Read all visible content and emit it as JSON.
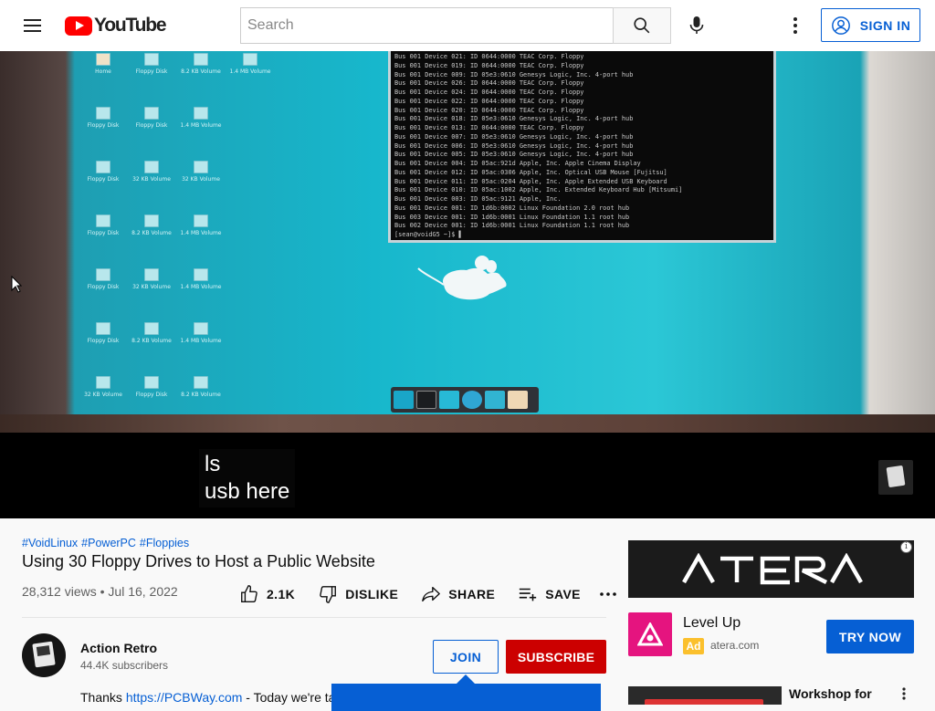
{
  "header": {
    "logo_text": "YouTube",
    "search_placeholder": "Search",
    "sign_in_label": "SIGN IN"
  },
  "player": {
    "terminal_lines": [
      "Bus 001 Device 021: ID 0644:0000 TEAC Corp. Floppy",
      "Bus 001 Device 019: ID 0644:0000 TEAC Corp. Floppy",
      "Bus 001 Device 009: ID 05e3:0610 Genesys Logic, Inc. 4-port hub",
      "Bus 001 Device 026: ID 0644:0000 TEAC Corp. Floppy",
      "Bus 001 Device 024: ID 0644:0000 TEAC Corp. Floppy",
      "Bus 001 Device 022: ID 0644:0000 TEAC Corp. Floppy",
      "Bus 001 Device 020: ID 0644:0000 TEAC Corp. Floppy",
      "Bus 001 Device 018: ID 05e3:0610 Genesys Logic, Inc. 4-port hub",
      "Bus 001 Device 013: ID 0644:0000 TEAC Corp. Floppy",
      "Bus 001 Device 007: ID 05e3:0610 Genesys Logic, Inc. 4-port hub",
      "Bus 001 Device 006: ID 05e3:0610 Genesys Logic, Inc. 4-port hub",
      "Bus 001 Device 005: ID 05e3:0610 Genesys Logic, Inc. 4-port hub",
      "Bus 001 Device 004: ID 05ac:921d Apple, Inc. Apple Cinema Display",
      "Bus 001 Device 012: ID 05ac:0306 Apple, Inc. Optical USB Mouse [Fujitsu]",
      "Bus 001 Device 011: ID 05ac:0204 Apple, Inc. Apple Extended USB Keyboard",
      "Bus 001 Device 010: ID 05ac:1002 Apple, Inc. Extended Keyboard Hub [Mitsumi]",
      "Bus 001 Device 003: ID 05ac:9121 Apple, Inc.",
      "Bus 001 Device 001: ID 1d6b:0002 Linux Foundation 2.0 root hub",
      "Bus 003 Device 001: ID 1d6b:0001 Linux Foundation 1.1 root hub",
      "Bus 002 Device 001: ID 1d6b:0001 Linux Foundation 1.1 root hub",
      "[sean@voidG5 ~]$ ▌"
    ],
    "desktop_icons": [
      "Home",
      "Floppy Disk",
      "8.2 KB Volume",
      "1.4 MB Volume",
      "Floppy Disk",
      "Floppy Disk",
      "1.4 MB Volume",
      "Floppy Disk",
      "32 KB Volume",
      "32 KB Volume",
      "Floppy Disk",
      "8.2 KB Volume",
      "1.4 MB Volume",
      "Floppy Disk",
      "32 KB Volume",
      "1.4 MB Volume",
      "Floppy Disk",
      "8.2 KB Volume",
      "1.4 MB Volume",
      "32 KB Volume",
      "Floppy Disk",
      "8.2 KB Volume"
    ],
    "caption_line1": "ls",
    "caption_line2": "usb here"
  },
  "video": {
    "hashtags": [
      "#VoidLinux",
      "#PowerPC",
      "#Floppies"
    ],
    "title": "Using 30 Floppy Drives to Host a Public Website",
    "views": "28,312 views",
    "date": "Jul 16, 2022",
    "meta_sep": "•",
    "like_count": "2.1K",
    "dislike_label": "DISLIKE",
    "share_label": "SHARE",
    "save_label": "SAVE"
  },
  "channel": {
    "name": "Action Retro",
    "subscribers": "44.4K subscribers",
    "join_label": "JOIN",
    "subscribe_label": "SUBSCRIBE",
    "description_prefix": "Thanks ",
    "description_link": "https://PCBWay.com",
    "description_rest": " - Today we're ta"
  },
  "sidebar": {
    "ad_brand": "ATERA",
    "ad_title": "Level Up",
    "ad_badge": "Ad",
    "ad_domain": "atera.com",
    "ad_cta": "TRY NOW",
    "rec_title": "Workshop for"
  },
  "colors": {
    "brand_red": "#ff0000",
    "subscribe_red": "#cc0000",
    "link_blue": "#065fd4",
    "ad_pink": "#e5147f"
  }
}
